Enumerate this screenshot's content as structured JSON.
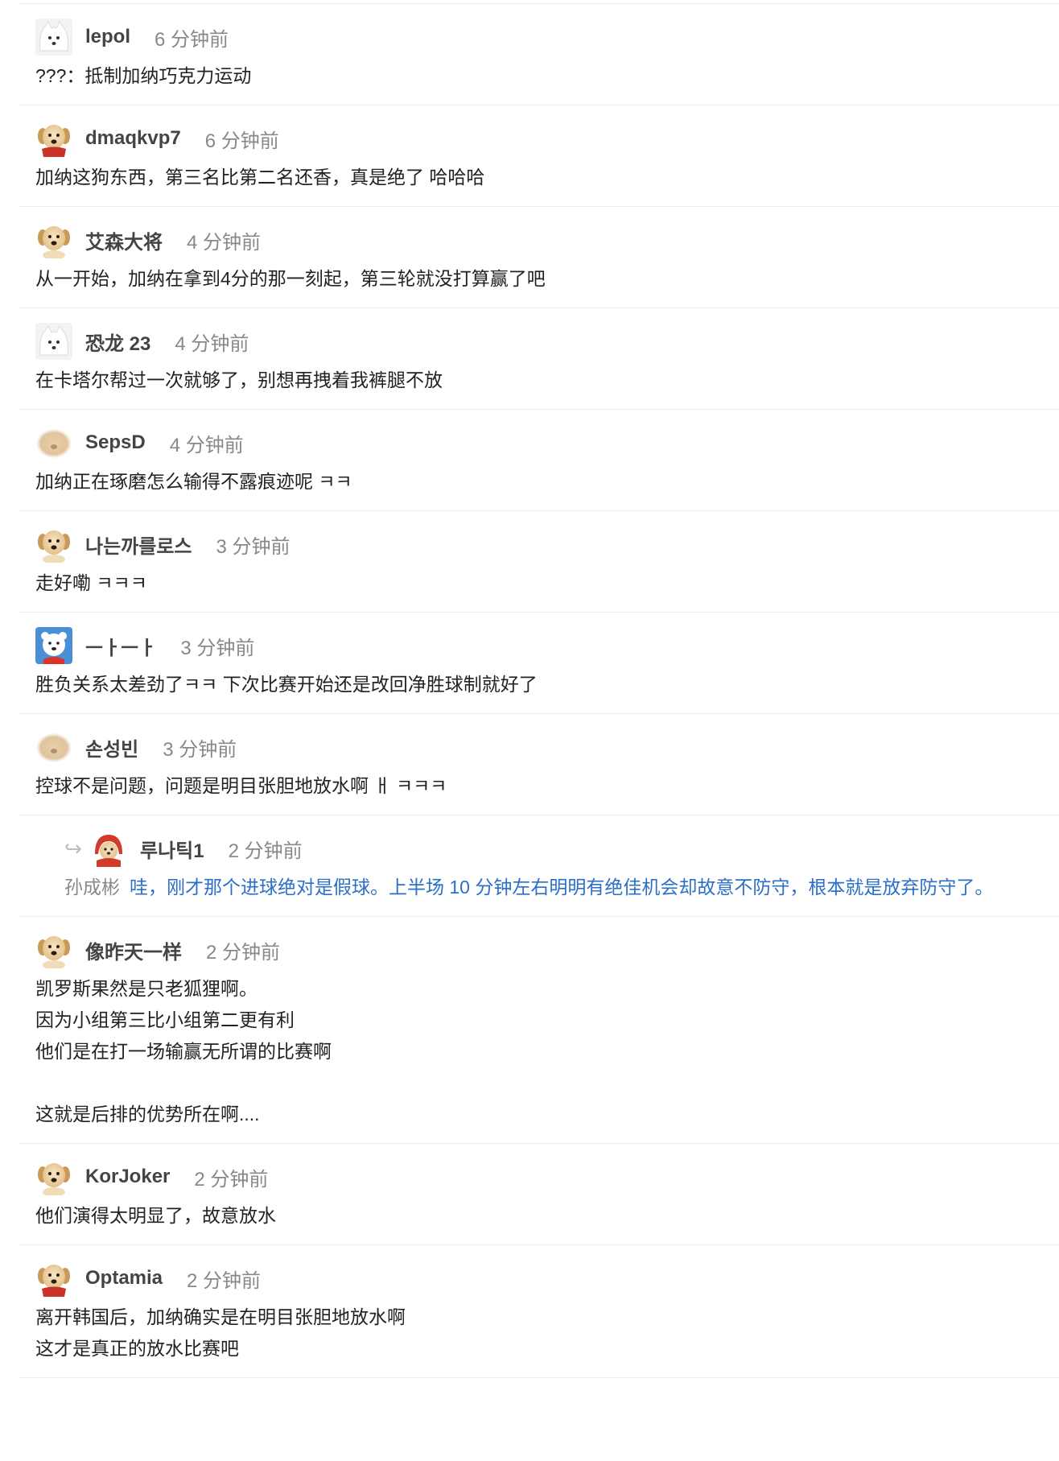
{
  "comments": [
    {
      "avatar": "samoyed-avatar",
      "name": "lepol",
      "time": "6 分钟前",
      "text": "???：抵制加纳巧克力运动"
    },
    {
      "avatar": "puppy-scarf-avatar",
      "name": "dmaqkvp7",
      "time": "6 分钟前",
      "text": "加纳这狗东西，第三名比第二名还香，真是绝了 哈哈哈"
    },
    {
      "avatar": "puppy-avatar",
      "name": "艾森大将",
      "time": "4 分钟前",
      "text": "从一开始，加纳在拿到4分的那一刻起，第三轮就没打算赢了吧"
    },
    {
      "avatar": "samoyed-avatar",
      "name": "恐龙 23",
      "time": "4 分钟前",
      "text": "在卡塔尔帮过一次就够了，别想再拽着我裤腿不放"
    },
    {
      "avatar": "blurred-puppy-avatar",
      "name": "SepsD",
      "time": "4 分钟前",
      "text": "加纳正在琢磨怎么输得不露痕迹呢 ㅋㅋ"
    },
    {
      "avatar": "puppy-avatar",
      "name": "나는까를로스",
      "time": "3 分钟前",
      "text": "走好嘞 ㅋㅋㅋ"
    },
    {
      "avatar": "polar-bear-avatar",
      "name": "ㅡㅏㅡㅏ",
      "time": "3 分钟前",
      "text": "胜负关系太差劲了ㅋㅋ 下次比赛开始还是改回净胜球制就好了"
    },
    {
      "avatar": "blurred-puppy-avatar",
      "name": "손성빈",
      "time": "3 分钟前",
      "text": "控球不是问题，问题是明目张胆地放水啊 ㅐ ㅋㅋㅋ"
    }
  ],
  "reply": {
    "avatar": "red-hood-puppy-avatar",
    "name": "루나틱1",
    "time": "2 分钟前",
    "mention": "孙成彬",
    "text": "哇，刚才那个进球绝对是假球。上半场 10 分钟左右明明有绝佳机会却故意不防守，根本就是放弃防守了。"
  },
  "comments_after": [
    {
      "avatar": "puppy-avatar",
      "name": "像昨天一样",
      "time": "2 分钟前",
      "text": "凯罗斯果然是只老狐狸啊。\n因为小组第三比小组第二更有利\n他们是在打一场输赢无所谓的比赛啊\n\n这就是后排的优势所在啊...."
    },
    {
      "avatar": "puppy-avatar",
      "name": "KorJoker",
      "time": "2 分钟前",
      "text": "他们演得太明显了，故意放水"
    },
    {
      "avatar": "puppy-scarf-avatar",
      "name": "Optamia",
      "time": "2 分钟前",
      "text": "离开韩国后，加纳确实是在明目张胆地放水啊\n这才是真正的放水比赛吧"
    }
  ],
  "colors": {
    "link": "#2b6fc7",
    "muted": "#888888",
    "divider": "#ececec"
  }
}
